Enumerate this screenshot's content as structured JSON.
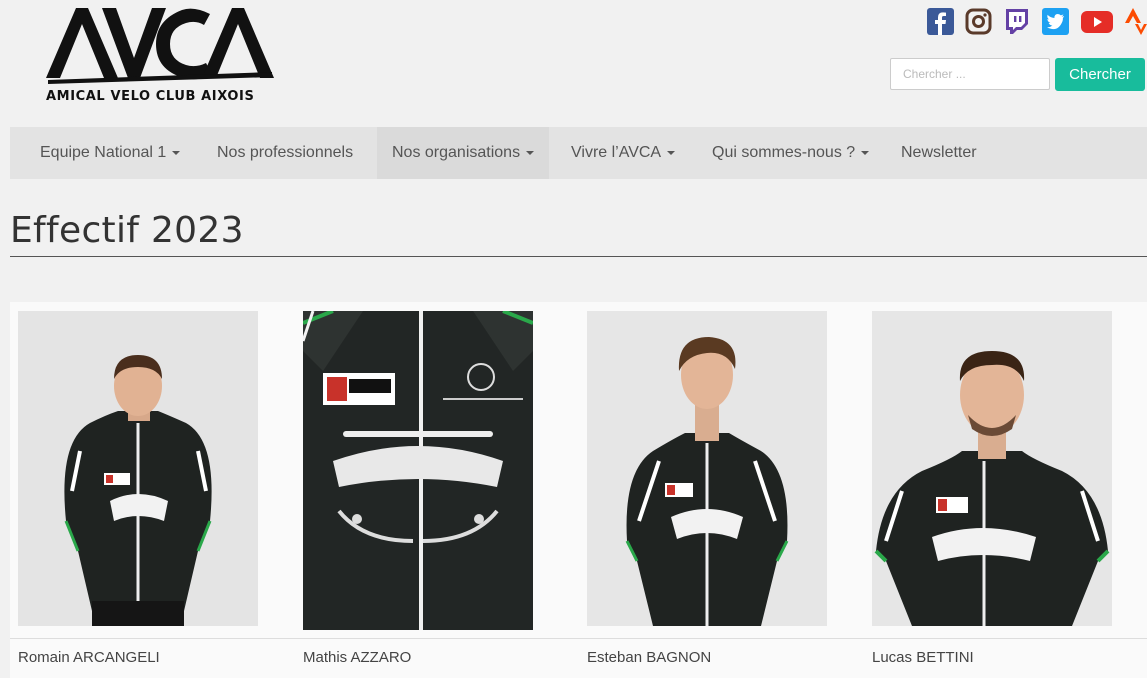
{
  "header": {
    "logo_text": "AVCA",
    "logo_subtitle": "AMICAL VELO CLUB AIXOIS",
    "social_icons": [
      "facebook-icon",
      "instagram-icon",
      "twitch-icon",
      "twitter-icon",
      "youtube-icon",
      "strava-icon"
    ],
    "search": {
      "placeholder": "Chercher ...",
      "button_label": "Chercher"
    },
    "colors": {
      "accent": "#18bc9c",
      "facebook": "#3b5998",
      "instagram": "#8a3ab9",
      "twitch": "#6441a5",
      "twitter": "#1da1f2",
      "youtube": "#e52d27",
      "strava": "#fc4c02"
    }
  },
  "nav": {
    "items": [
      {
        "label": "Equipe National 1",
        "dropdown": true
      },
      {
        "label": "Nos professionnels",
        "dropdown": false
      },
      {
        "label": "Nos organisations",
        "dropdown": true
      },
      {
        "label": "Vivre l’AVCA",
        "dropdown": true
      },
      {
        "label": "Qui sommes-nous ?",
        "dropdown": true
      },
      {
        "label": "Newsletter",
        "dropdown": false
      }
    ]
  },
  "main": {
    "title": "Effectif 2023",
    "riders": [
      {
        "name": "Romain ARCANGELI"
      },
      {
        "name": "Mathis AZZARO"
      },
      {
        "name": "Esteban BAGNON"
      },
      {
        "name": "Lucas BETTINI"
      }
    ]
  }
}
